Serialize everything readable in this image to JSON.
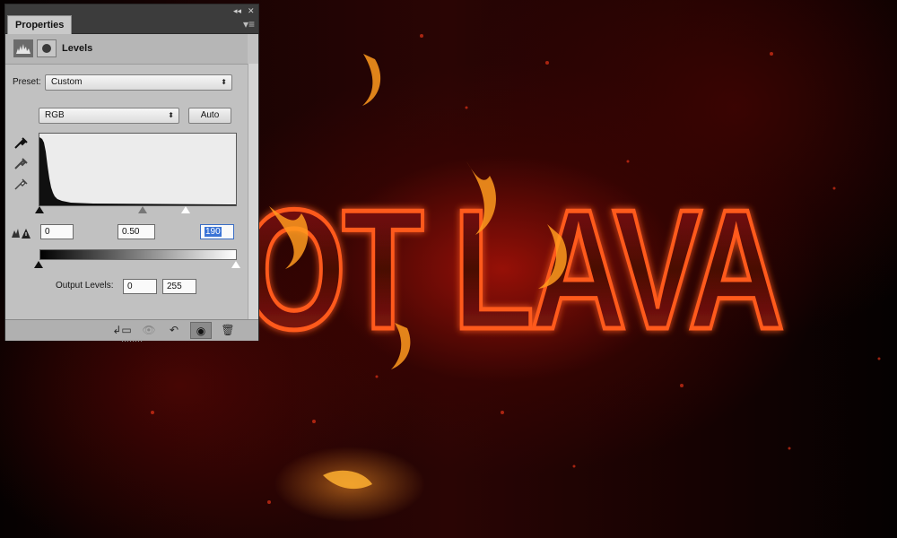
{
  "panel": {
    "tab_label": "Properties",
    "collapse_glyph": "◂◂",
    "close_glyph": "✕",
    "menu_glyph": "▾≡",
    "title": "Levels",
    "icons": [
      "histogram-icon",
      "mask-icon"
    ]
  },
  "preset": {
    "label": "Preset:",
    "value": "Custom"
  },
  "channel": {
    "value": "RGB",
    "auto_label": "Auto"
  },
  "input_levels": {
    "black": "0",
    "gamma": "0.50",
    "white": "190"
  },
  "output_levels": {
    "label": "Output Levels:",
    "black": "0",
    "white": "255"
  },
  "footer_buttons": [
    "clip-to-layer-icon",
    "view-previous-icon",
    "reset-icon",
    "eye-icon",
    "trash-icon"
  ],
  "glyphs": {
    "select_arrow": "⬍",
    "reset": "↶",
    "eye": "◉",
    "trash": "🗑",
    "view_previous": "👁",
    "clip": "↲▭"
  },
  "canvas_text": {
    "headline": "OT LAVA"
  }
}
